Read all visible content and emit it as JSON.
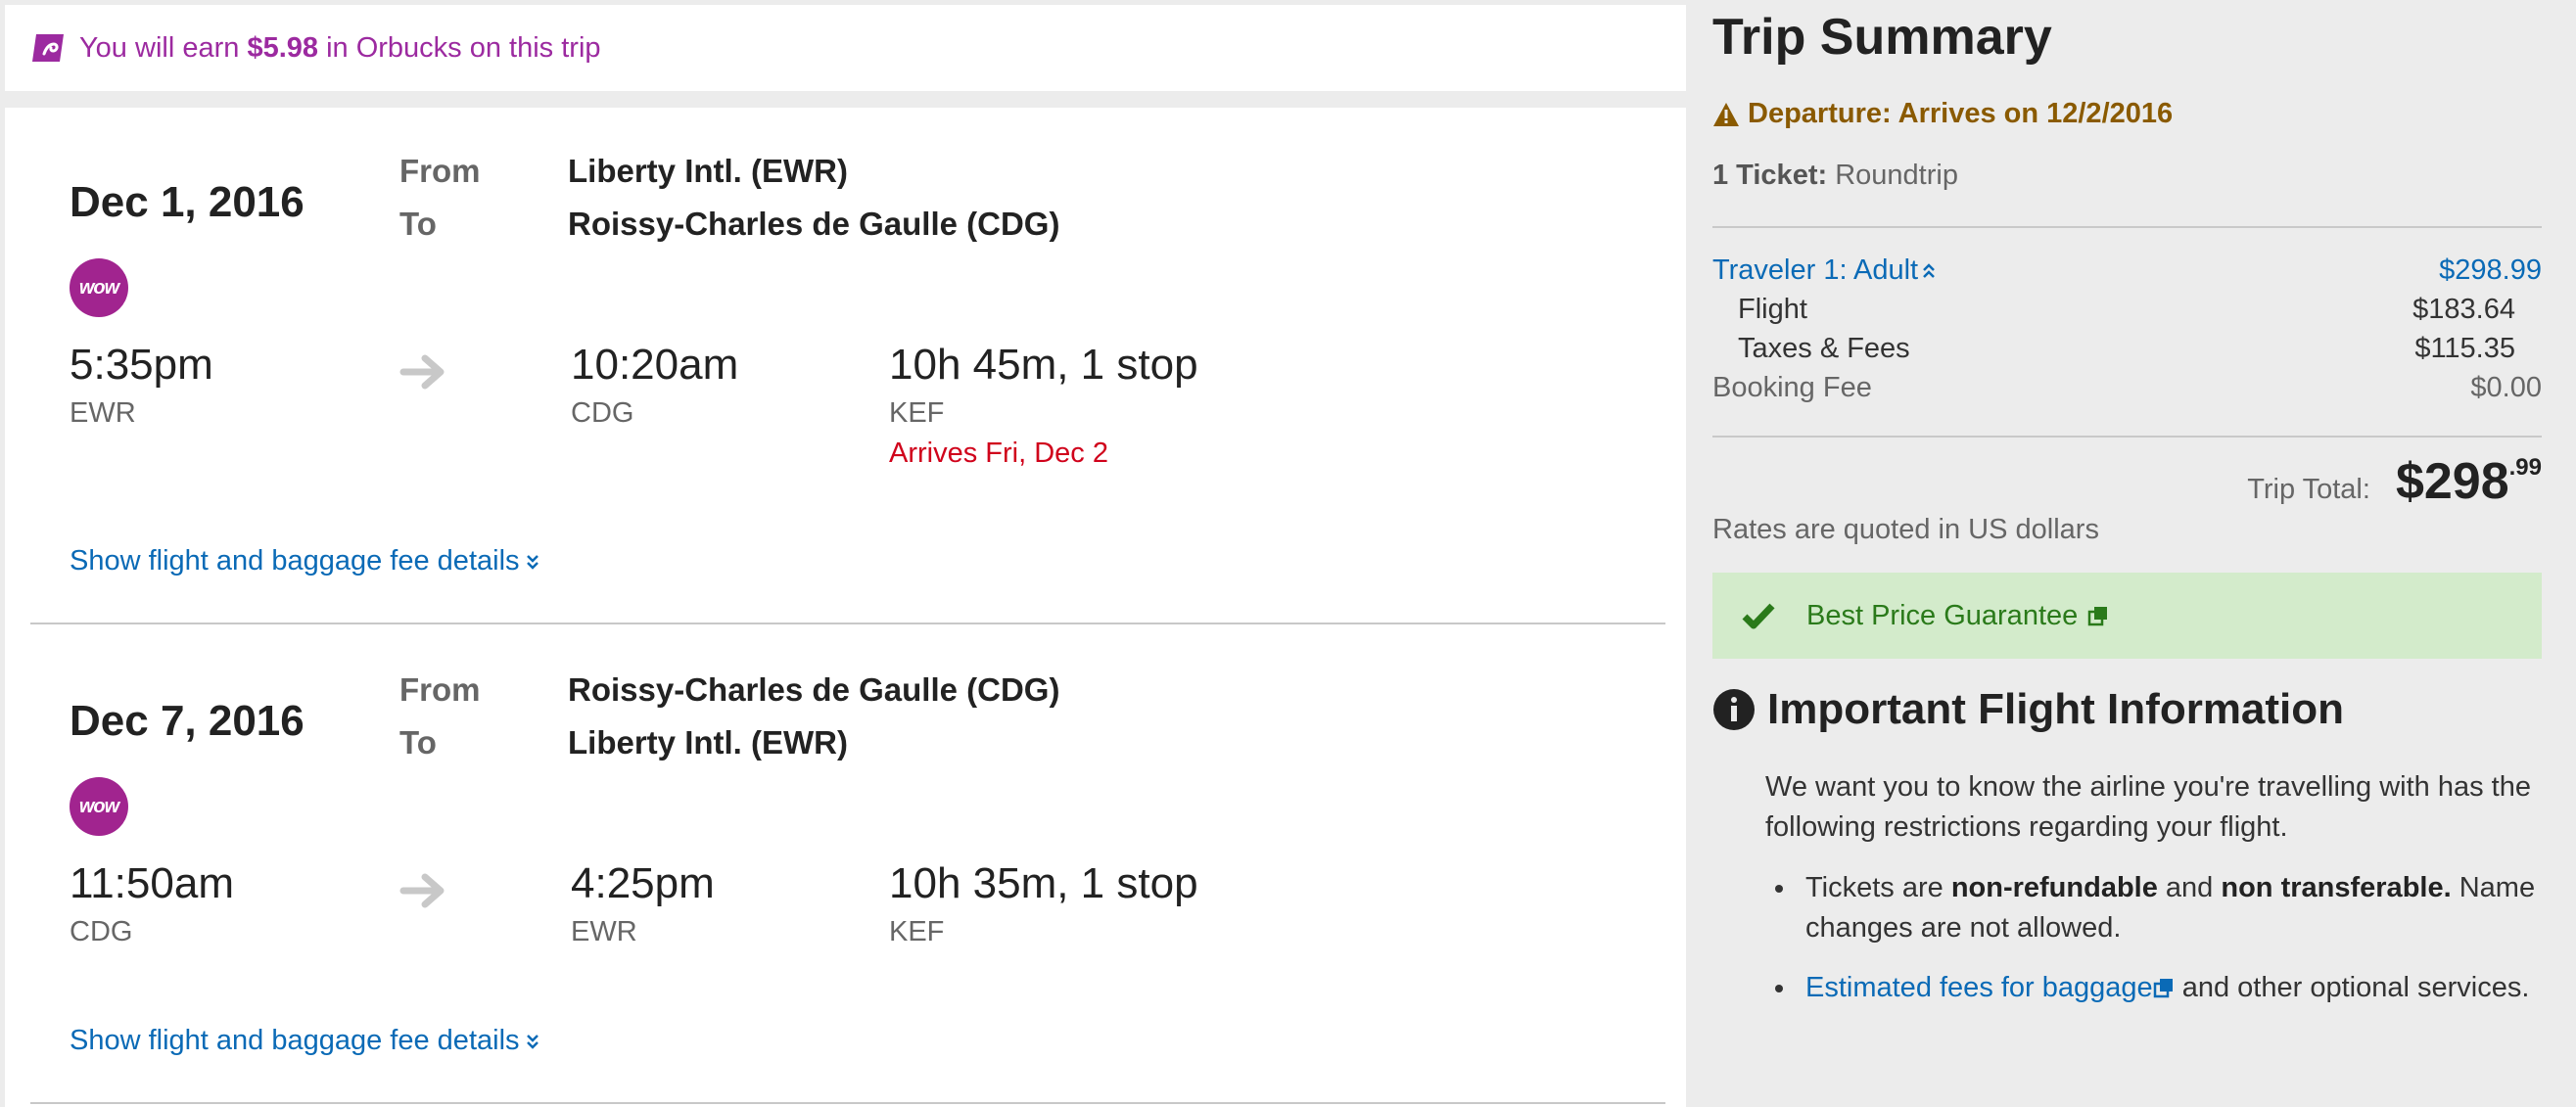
{
  "orbucks": {
    "prefix": "You will earn",
    "amount": "$5.98",
    "suffix": "in Orbucks on this trip"
  },
  "segments": [
    {
      "date": "Dec 1, 2016",
      "from_label": "From",
      "to_label": "To",
      "from": "Liberty Intl. (EWR)",
      "to": "Roissy-Charles de Gaulle (CDG)",
      "airline_logo": "wow",
      "depart_time": "5:35pm",
      "depart_airport": "EWR",
      "arrive_time": "10:20am",
      "arrive_airport": "CDG",
      "duration": "10h 45m, 1 stop",
      "stop_airport": "KEF",
      "arrival_note": "Arrives Fri, Dec 2",
      "details_link": "Show flight and baggage fee details"
    },
    {
      "date": "Dec 7, 2016",
      "from_label": "From",
      "to_label": "To",
      "from": "Roissy-Charles de Gaulle (CDG)",
      "to": "Liberty Intl. (EWR)",
      "airline_logo": "wow",
      "depart_time": "11:50am",
      "depart_airport": "CDG",
      "arrive_time": "4:25pm",
      "arrive_airport": "EWR",
      "duration": "10h 35m, 1 stop",
      "stop_airport": "KEF",
      "details_link": "Show flight and baggage fee details"
    }
  ],
  "summary": {
    "title": "Trip Summary",
    "departure_note": "Departure: Arrives on 12/2/2016",
    "ticket_label": "1 Ticket:",
    "ticket_type": "Roundtrip",
    "traveler_label": "Traveler 1: Adult",
    "traveler_total": "$298.99",
    "flight_label": "Flight",
    "flight_value": "$183.64",
    "taxes_label": "Taxes & Fees",
    "taxes_value": "$115.35",
    "booking_label": "Booking Fee",
    "booking_value": "$0.00",
    "total_label": "Trip Total:",
    "total_dollars": "$298",
    "total_cents": ".99",
    "rates_note": "Rates are quoted in US dollars",
    "best_price": "Best Price Guarantee"
  },
  "important": {
    "title": "Important Flight Information",
    "intro": "We want you to know the airline you're travelling with has the following restrictions regarding your flight.",
    "b1_a": "Tickets are",
    "b1_b": "non-refundable",
    "b1_c": "and",
    "b1_d": "non transferable.",
    "b1_e": "Name changes are not allowed.",
    "b2_link": "Estimated fees for baggage",
    "b2_rest": "and other optional services."
  },
  "colors": {
    "orbucks_purple": "#9c2aa0",
    "link_blue": "#0a6ab6",
    "alert_red": "#d0021b",
    "warning_brown": "#8a5a00",
    "success_green": "#2a7a1a",
    "success_bg": "#d3ebcb"
  }
}
